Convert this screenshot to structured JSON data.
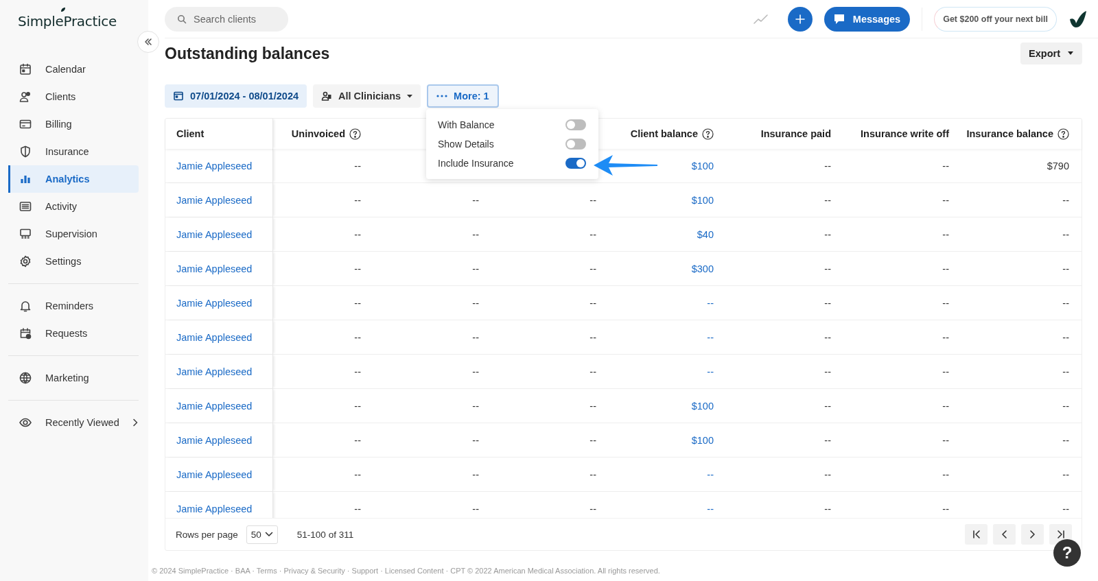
{
  "sidebar": {
    "logo": "SimplePractice",
    "groups": [
      {
        "items": [
          {
            "label": "Calendar",
            "selected": false
          },
          {
            "label": "Clients",
            "selected": false
          },
          {
            "label": "Billing",
            "selected": false
          },
          {
            "label": "Insurance",
            "selected": false
          },
          {
            "label": "Analytics",
            "selected": true
          },
          {
            "label": "Activity",
            "selected": false
          },
          {
            "label": "Supervision",
            "selected": false
          },
          {
            "label": "Settings",
            "selected": false
          }
        ]
      },
      {
        "items": [
          {
            "label": "Reminders",
            "selected": false
          },
          {
            "label": "Requests",
            "selected": false
          }
        ]
      },
      {
        "items": [
          {
            "label": "Marketing",
            "selected": false
          }
        ]
      },
      {
        "items": [
          {
            "label": "Recently Viewed",
            "selected": false,
            "submenu": true
          }
        ]
      }
    ]
  },
  "topbar": {
    "search": {
      "placeholder": "Search clients"
    },
    "messages": "Messages",
    "promo": "Get $200 off your next bill"
  },
  "page": {
    "title": "Outstanding balances",
    "export": "Export"
  },
  "filters": [
    {
      "kind": "date",
      "label": "07/01/2024 - 08/01/2024"
    },
    {
      "kind": "dropdown",
      "label": "All Clinicians"
    },
    {
      "kind": "more",
      "label": "More: 1",
      "open": true
    }
  ],
  "more_menu": {
    "toggles": [
      {
        "label": "With Balance",
        "on": false
      },
      {
        "label": "Show Details",
        "on": false
      },
      {
        "label": "Include Insurance",
        "on": true
      }
    ]
  },
  "table": {
    "columns": [
      {
        "label": "Client",
        "help": false,
        "linked": true
      },
      {
        "label": "Uninvoiced",
        "help": true,
        "linked": false
      },
      {
        "linked": false
      },
      {
        "linked": false
      },
      {
        "label": "Client balance",
        "help": true,
        "linked": true
      },
      {
        "label": "Insurance paid",
        "help": false,
        "linked": false
      },
      {
        "label": "Insurance write off",
        "help": false,
        "linked": false
      },
      {
        "label": "Insurance balance",
        "help": true,
        "linked": false
      }
    ],
    "rows": [
      {
        "cells": [
          "Jamie Appleseed",
          "--",
          null,
          null,
          "$100",
          "--",
          "--",
          "$790"
        ]
      },
      {
        "cells": [
          "Jamie Appleseed",
          "--",
          "--",
          "--",
          "$100",
          "--",
          "--",
          "--"
        ]
      },
      {
        "cells": [
          "Jamie Appleseed",
          "--",
          "--",
          "--",
          "$40",
          "--",
          "--",
          "--"
        ]
      },
      {
        "cells": [
          "Jamie Appleseed",
          "--",
          "--",
          "--",
          "$300",
          "--",
          "--",
          "--"
        ]
      },
      {
        "cells": [
          "Jamie Appleseed",
          "--",
          "--",
          "--",
          "--",
          "--",
          "--",
          "--"
        ]
      },
      {
        "cells": [
          "Jamie Appleseed",
          "--",
          "--",
          "--",
          "--",
          "--",
          "--",
          "--"
        ]
      },
      {
        "cells": [
          "Jamie Appleseed",
          "--",
          "--",
          "--",
          "--",
          "--",
          "--",
          "--"
        ]
      },
      {
        "cells": [
          "Jamie Appleseed",
          "--",
          "--",
          "--",
          "$100",
          "--",
          "--",
          "--"
        ]
      },
      {
        "cells": [
          "Jamie Appleseed",
          "--",
          "--",
          "--",
          "$100",
          "--",
          "--",
          "--"
        ]
      },
      {
        "cells": [
          "Jamie Appleseed",
          "--",
          "--",
          "--",
          "--",
          "--",
          "--",
          "--"
        ]
      },
      {
        "cells": [
          "Jamie Appleseed",
          "--",
          "--",
          "--",
          "--",
          "--",
          "--",
          "--"
        ]
      }
    ]
  },
  "pagination": {
    "label": "Rows per page",
    "per_page": "50",
    "range": "51-100 of 311"
  },
  "footer": "© 2024 SimplePractice · BAA · Terms · Privacy & Security · Support · Licensed Content · CPT © 2022 American Medical Association. All rights reserved.",
  "help_button": "?"
}
